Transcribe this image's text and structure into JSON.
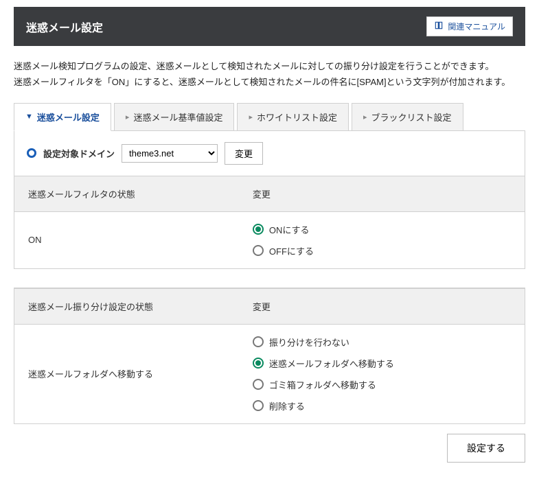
{
  "header": {
    "title": "迷惑メール設定",
    "manual_button": "関連マニュアル"
  },
  "description": {
    "line1": "迷惑メール検知プログラムの設定、迷惑メールとして検知されたメールに対しての振り分け設定を行うことができます。",
    "line2": "迷惑メールフィルタを「ON」にすると、迷惑メールとして検知されたメールの件名に[SPAM]という文字列が付加されます。"
  },
  "tabs": {
    "spam_settings": "迷惑メール設定",
    "threshold_settings": "迷惑メール基準値設定",
    "whitelist_settings": "ホワイトリスト設定",
    "blacklist_settings": "ブラックリスト設定"
  },
  "domain_section": {
    "label": "設定対象ドメイン",
    "selected": "theme3.net",
    "change_button": "変更"
  },
  "filter_table": {
    "header_state": "迷惑メールフィルタの状態",
    "header_change": "変更",
    "current_state": "ON",
    "options": {
      "on": "ONにする",
      "off": "OFFにする"
    }
  },
  "sort_table": {
    "header_state": "迷惑メール振り分け設定の状態",
    "header_change": "変更",
    "current_state": "迷惑メールフォルダへ移動する",
    "options": {
      "none": "振り分けを行わない",
      "spam_folder": "迷惑メールフォルダへ移動する",
      "trash_folder": "ゴミ箱フォルダへ移動する",
      "delete": "削除する"
    }
  },
  "footer": {
    "submit": "設定する"
  }
}
